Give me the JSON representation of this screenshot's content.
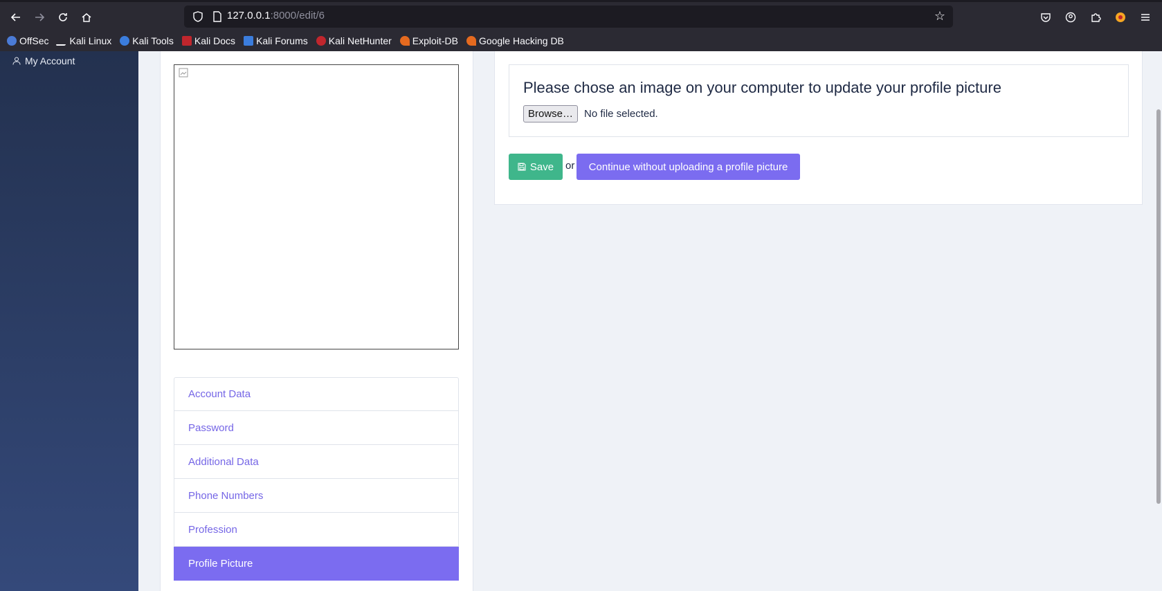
{
  "browser": {
    "url_host": "127.0.0.1",
    "url_rest": ":8000/edit/6",
    "nav": {
      "back_icon": "arrow-left-icon",
      "forward_icon": "arrow-right-icon",
      "reload_icon": "reload-icon",
      "home_icon": "home-icon"
    },
    "bookmarks": [
      {
        "label": "OffSec",
        "color": "#4b7bd6"
      },
      {
        "label": "Kali Linux",
        "color": "#2b2a33"
      },
      {
        "label": "Kali Tools",
        "color": "#d9534f"
      },
      {
        "label": "Kali Docs",
        "color": "#c0262d"
      },
      {
        "label": "Kali Forums",
        "color": "#3b7ddd"
      },
      {
        "label": "Kali NetHunter",
        "color": "#c0262d"
      },
      {
        "label": "Exploit-DB",
        "color": "#e56a1f"
      },
      {
        "label": "Google Hacking DB",
        "color": "#e56a1f"
      }
    ]
  },
  "sidebar": {
    "my_account": "My Account"
  },
  "profile": {
    "menu": [
      {
        "label": "Account Data",
        "active": false
      },
      {
        "label": "Password",
        "active": false
      },
      {
        "label": "Additional Data",
        "active": false
      },
      {
        "label": "Phone Numbers",
        "active": false
      },
      {
        "label": "Profession",
        "active": false
      },
      {
        "label": "Profile Picture",
        "active": true
      }
    ]
  },
  "upload": {
    "heading": "Please chose an image on your computer to update your profile picture",
    "browse_label": "Browse…",
    "no_file": "No file selected.",
    "save_label": "Save",
    "or_text": "or",
    "continue_label": "Continue without uploading a profile picture"
  },
  "colors": {
    "accent": "#7b6cf0",
    "success": "#3fb68b",
    "sidebar": "#2c3d66"
  }
}
